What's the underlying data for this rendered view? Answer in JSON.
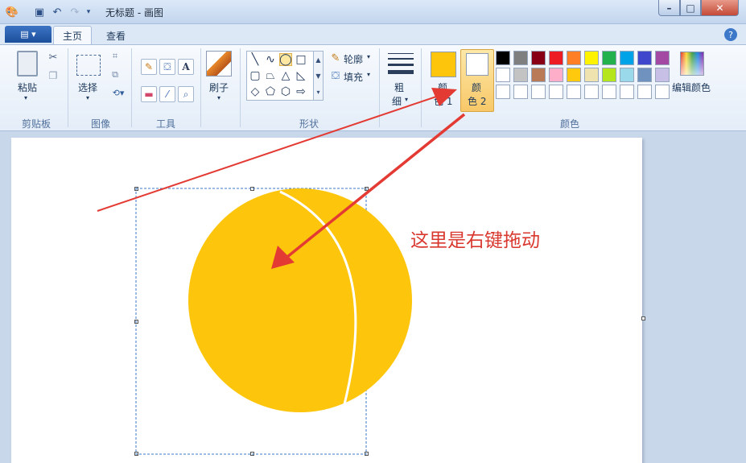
{
  "window": {
    "title": "无标题 - 画图",
    "min_icon": "minimize-icon",
    "max_icon": "maximize-icon",
    "close_icon": "close-icon"
  },
  "quick_access": {
    "app_icon": "paint-app-icon",
    "save_icon": "save-icon",
    "undo_icon": "undo-icon",
    "redo_icon": "redo-icon",
    "customize_icon": "dropdown-icon"
  },
  "tabs": [
    {
      "label": "主页",
      "active": true
    },
    {
      "label": "查看",
      "active": false
    }
  ],
  "ribbon": {
    "clipboard": {
      "paste_label": "粘贴",
      "group_label": "剪贴板"
    },
    "image": {
      "select_label": "选择",
      "group_label": "图像"
    },
    "tools": {
      "group_label": "工具"
    },
    "brushes": {
      "label": "刷子"
    },
    "shapes": {
      "outline_label": "轮廓",
      "fill_label": "填充",
      "group_label": "形状"
    },
    "size": {
      "label_line1": "粗",
      "label_line2": "细"
    },
    "colors": {
      "color1_label_line1": "颜",
      "color1_label_line2": "色 1",
      "color2_label_line1": "颜",
      "color2_label_line2": "色 2",
      "color1_value": "#fdc50c",
      "color2_value": "#ffffff",
      "edit_colors_label": "编辑颜色",
      "group_label": "颜色",
      "palette_row1": [
        "#000000",
        "#7f7f7f",
        "#880015",
        "#ed1c24",
        "#ff7f27",
        "#fff200",
        "#22b14c",
        "#00a2e8",
        "#3f48cc",
        "#a349a4"
      ],
      "palette_row2": [
        "#ffffff",
        "#c3c3c3",
        "#b97a57",
        "#ffaec9",
        "#ffc90e",
        "#efe4b0",
        "#b5e61d",
        "#99d9ea",
        "#7092be",
        "#c8bfe7"
      ]
    }
  },
  "canvas": {
    "annotation_text": "这里是右键拖动",
    "circle_color": "#fdc50c",
    "annotation_color": "#d9382f"
  }
}
